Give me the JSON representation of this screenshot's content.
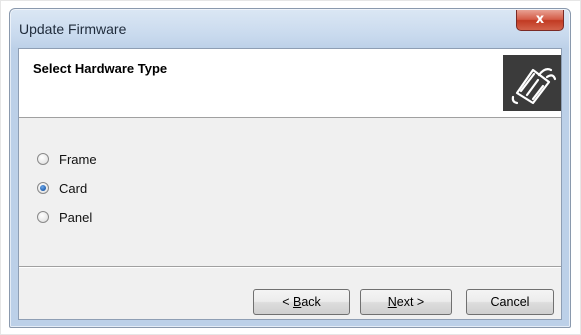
{
  "window": {
    "title": "Update Firmware",
    "close_glyph": "x"
  },
  "header": {
    "title": "Select Hardware Type",
    "icon": "hardware-card-icon"
  },
  "options": [
    {
      "label": "Frame",
      "checked": false
    },
    {
      "label": "Card",
      "checked": true
    },
    {
      "label": "Panel",
      "checked": false
    }
  ],
  "buttons": {
    "back": {
      "prefix": "< ",
      "mnemonic": "B",
      "rest": "ack"
    },
    "next": {
      "mnemonic": "N",
      "rest": "ext >"
    },
    "cancel": {
      "label": "Cancel"
    }
  },
  "colors": {
    "title_bar": "#c9daee",
    "close_button": "#c13a22",
    "dialog_bg": "#f0f0f0",
    "icon_bg": "#3b3b3b"
  }
}
